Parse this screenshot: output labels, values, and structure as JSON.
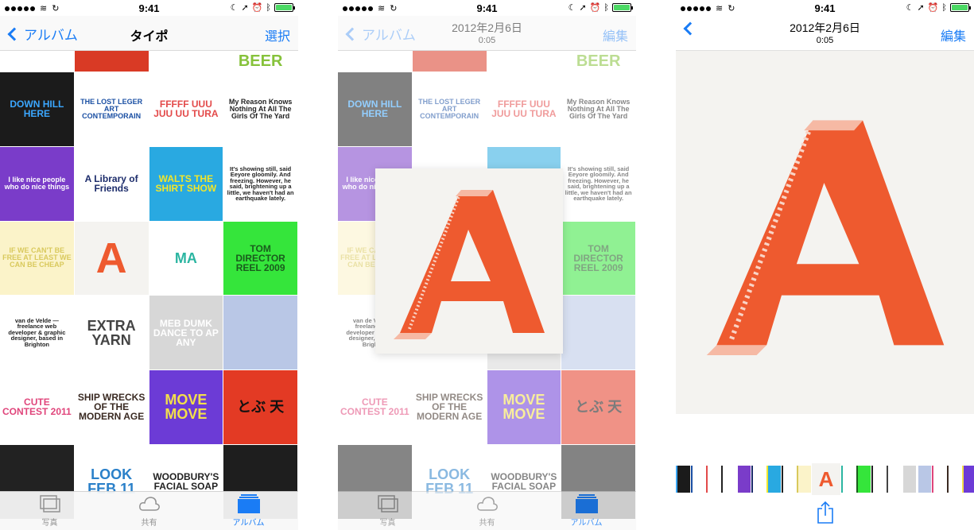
{
  "status": {
    "time": "9:41"
  },
  "screen1": {
    "back_label": "アルバム",
    "title": "タイポ",
    "action_label": "選択",
    "tabs": [
      {
        "label": "写真",
        "active": false
      },
      {
        "label": "共有",
        "active": false
      },
      {
        "label": "アルバム",
        "active": true
      }
    ]
  },
  "screen2": {
    "back_label": "アルバム",
    "title": "2012年2月6日",
    "subtitle": "0:05",
    "action_label": "編集",
    "tabs": [
      {
        "label": "写真",
        "active": false
      },
      {
        "label": "共有",
        "active": false
      },
      {
        "label": "アルバム",
        "active": true
      }
    ]
  },
  "screen3": {
    "title": "2012年2月6日",
    "subtitle": "0:05",
    "action_label": "編集"
  },
  "tiles": [
    {
      "text": "DOWN HILL HERE",
      "bg": "#1b1b1b",
      "fg": "#3ba7ff"
    },
    {
      "text": "THE LOST LEGER ART CONTEMPORAIN",
      "bg": "#ffffff",
      "fg": "#1a4fa3"
    },
    {
      "text": "FFFFF UUU JUU UU TURA",
      "bg": "#ffffff",
      "fg": "#e34a4a"
    },
    {
      "text": "My Reason Knows Nothing At All The Girls Of The Yard",
      "bg": "#ffffff",
      "fg": "#222222"
    },
    {
      "text": "I like nice people who do nice things",
      "bg": "#7a3cc9",
      "fg": "#ffffff"
    },
    {
      "text": "A Library of Friends",
      "bg": "#ffffff",
      "fg": "#1c2c6b"
    },
    {
      "text": "WALTS THE SHIRT SHOW",
      "bg": "#29a9e1",
      "fg": "#f1e62a"
    },
    {
      "text": "It's showing still, said Eeyore gloomily. And freezing. However, he said, brightening up a little, we haven't had an earthquake lately.",
      "bg": "#ffffff",
      "fg": "#222222"
    },
    {
      "text": "IF WE CAN'T BE FREE AT LEAST WE CAN BE CHEAP",
      "bg": "#fbf3c9",
      "fg": "#d9c95c"
    },
    {
      "text": "A",
      "bg": "#f4f3f0",
      "fg": "#ee5a2f"
    },
    {
      "text": "MA",
      "bg": "#ffffff",
      "fg": "#2bb5a1"
    },
    {
      "text": "TOM DIRECTOR REEL 2009",
      "bg": "#35e53b",
      "fg": "#1a5c1d"
    },
    {
      "text": "van de Velde — freelance web developer & graphic designer, based in Brighton",
      "bg": "#ffffff",
      "fg": "#222222"
    },
    {
      "text": "EXTRA YARN",
      "bg": "#ffffff",
      "fg": "#444444"
    },
    {
      "text": "MEB DUMK DANCE TO AP ANY",
      "bg": "#d7d7d7",
      "fg": "#ffffff"
    },
    {
      "text": "",
      "bg": "#b9c7e6",
      "fg": "#ffffff"
    },
    {
      "text": "CUTE CONTEST 2011",
      "bg": "#ffffff",
      "fg": "#e0457b"
    },
    {
      "text": "SHIP WRECKS OF THE MODERN AGE",
      "bg": "#ffffff",
      "fg": "#3a2a22"
    },
    {
      "text": "MOVE MOVE",
      "bg": "#6c3bd6",
      "fg": "#f3e04a"
    },
    {
      "text": "とぶ 天",
      "bg": "#e33a24",
      "fg": "#111111"
    },
    {
      "text": "",
      "bg": "#222222",
      "fg": "#f0c24a"
    },
    {
      "text": "LOOK FEB 11",
      "bg": "#ffffff",
      "fg": "#2a80c9"
    },
    {
      "text": "WOODBURY'S FACIAL SOAP",
      "bg": "#ffffff",
      "fg": "#222222"
    },
    {
      "text": "",
      "bg": "#1e1e1e",
      "fg": "#ffffff"
    }
  ],
  "top_strip": [
    {
      "bg": "#ffffff",
      "fg": "#3b7ad9"
    },
    {
      "bg": "#d93a25",
      "fg": "#ffffff"
    },
    {
      "bg": "#ffffff",
      "fg": "#e34a4a"
    },
    {
      "bg": "#ffffff",
      "fg": "#86c23b",
      "text": "BEER"
    }
  ],
  "zoom_letter": "A",
  "colors": {
    "accent": "#1a7cf5",
    "poster_orange": "#ee5a2f",
    "poster_bg": "#f4f3f0"
  }
}
